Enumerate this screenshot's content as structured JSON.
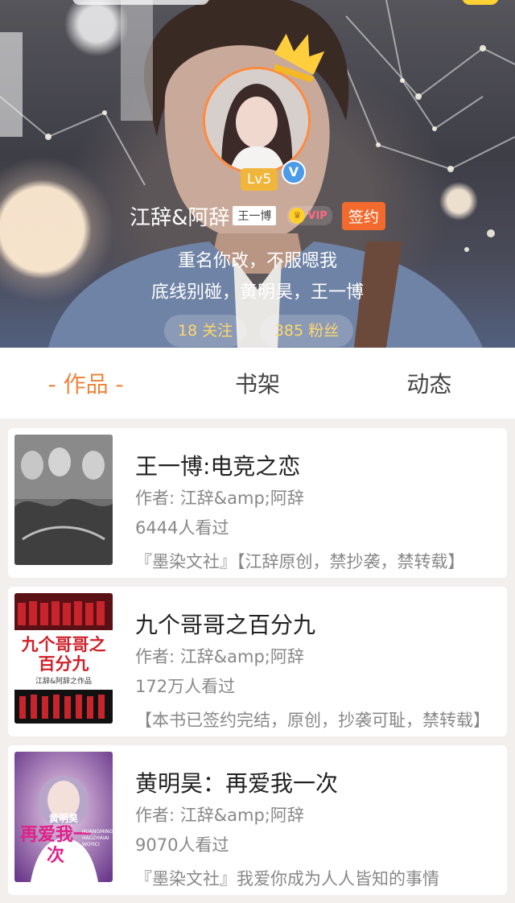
{
  "profile": {
    "level": "Lv5",
    "verified_mark": "V",
    "username": "江辞&阿辞",
    "name_tag": "王一博",
    "vip_label": "VIP",
    "sign_label": "签约",
    "bio_line1": "重名你改，不服嗯我",
    "bio_line2": "底线别碰，黄明昊，王一博",
    "following": "18 关注",
    "fans": "385 粉丝"
  },
  "tabs": [
    {
      "label": "- 作品 -",
      "active": true
    },
    {
      "label": "书架",
      "active": false
    },
    {
      "label": "动态",
      "active": false
    }
  ],
  "books": [
    {
      "title": "王一博:电竞之恋",
      "author": "作者: 江辞&amp;阿辞",
      "views": "6444人看过",
      "desc": "『墨染文社』【江辞原创，禁抄袭，禁转载】"
    },
    {
      "title": "九个哥哥之百分九",
      "author": "作者: 江辞&amp;阿辞",
      "views": "172万人看过",
      "desc": "【本书已签约完结，原创，抄袭可耻，禁转载】",
      "cover_text": "九个哥哥之百分九",
      "cover_subtext": "江辞&阿辞之作品"
    },
    {
      "title": "黄明昊：再爱我一次",
      "author": "作者: 江辞&amp;阿辞",
      "views": "9070人看过",
      "desc": "『墨染文社』我爱你成为人人皆知的事情",
      "cover_text_top": "黄明昊",
      "cover_text_main": "再爱我一次",
      "cover_text_side": "HUANGMING HAOZHAIAI WOYICI"
    }
  ],
  "colors": {
    "accent": "#f0843e",
    "sign_button": "#f26a2d",
    "stat_text": "#ffd76a"
  },
  "icons": [
    "crown-icon",
    "verified-icon",
    "vip-icon"
  ]
}
